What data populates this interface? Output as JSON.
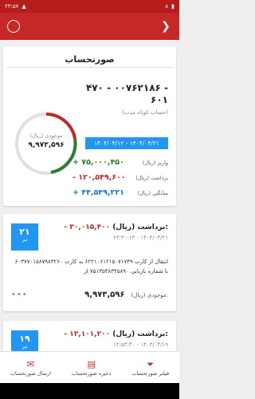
{
  "status_bar": {
    "time": "۲۳:۵۷",
    "battery": "۸"
  },
  "header": {
    "title": "صورتحساب"
  },
  "account": {
    "number": "۴۷۰ - ۰۰۷۶۲۱۸۶ - ۶۰۱",
    "type": "(حساب کوتاه مدت)",
    "balance_label": "موجودی (ریال)",
    "balance_value": "۹,۹۷۳,۵۹۶",
    "date_range": "۱۴۰۴/۰۴/۱۲ - ۱۴۰۴/۰۴/۲۱",
    "stats": [
      {
        "label": "واریز (ریال)",
        "value": "+ ۷۵,۰۰۰,۴۵۰"
      },
      {
        "label": "برداشت (ریال)",
        "value": "- ۱۲۰,۵۴۹,۶۰۰"
      },
      {
        "label": "میانگین (ریال)",
        "value": "+ ۴۴,۵۴۹,۲۲۱"
      }
    ]
  },
  "transactions": [
    {
      "day": "۲۱",
      "month": "تیر",
      "amount_label": "برداشت (ریال):",
      "amount": "- ۳۰,۰۱۵,۴۰۰",
      "time": "۲۳:۳۰:۱۳ - ۱۴۰۴/۰۴/۲۱",
      "description": "انتقال از کارت ۶۲۲۱۰۶۱۲۱۵۰۷۱۷۴۹ به کارت ۶۰۳۷۷۰۱۵۸۷۹۸۳۲۶۰ با شماره بازیابی ۷۵۱۳۵۳۸۳۴۵۸۹۰ از",
      "balance_label": "موجودی (ریال):",
      "balance": "۹,۹۷۳,۵۹۶",
      "more": "•••"
    },
    {
      "day": "۱۹",
      "month": "تیر",
      "amount_label": "برداشت (ریال):",
      "amount": "- ۱۳,۱۰۱,۲۰۰",
      "time": "۱۲:۵۳:۳۰ - ۱۴۰۴/۰۴/۱۹"
    }
  ],
  "bottom_nav": [
    {
      "label": "فیلتر صورتحساب"
    },
    {
      "label": "ذخیره صورتحساب"
    },
    {
      "label": "ارسال صورتحساب"
    }
  ]
}
